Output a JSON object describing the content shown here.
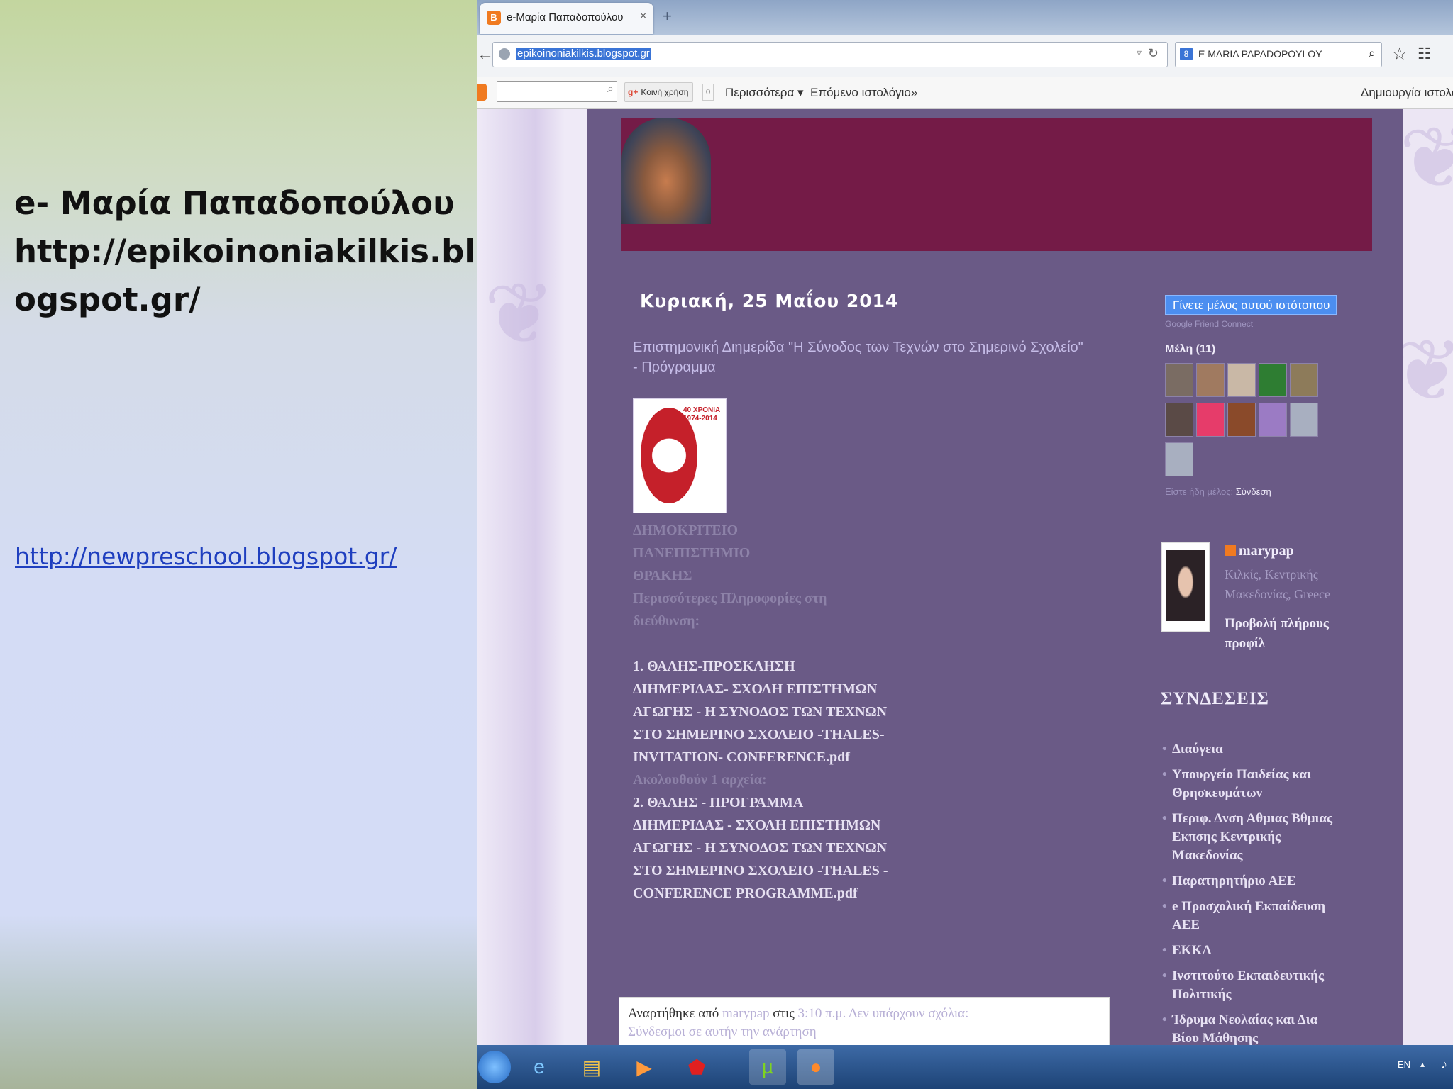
{
  "slide": {
    "title_lines": [
      "e- Μαρία Παπαδοπούλου",
      "http://epikoinoniakilkis.bl",
      "ogspot.gr/"
    ],
    "link": "http://newpreschool.blogspot.gr/"
  },
  "browser": {
    "tab_title": "e-Μαρία Παπαδοπούλου",
    "tab_close": "×",
    "new_tab": "+",
    "url": "epikoinoniakilkis.blogspot.gr",
    "search_text": "E MARIA PAPADOPOYLOY",
    "icons": [
      "back-arrow-icon",
      "reload-icon",
      "search-icon",
      "star-icon",
      "bookmarks-icon"
    ]
  },
  "blogger_bar": {
    "gplus_label": "Κοινή χρήση",
    "gplus_count": "0",
    "more_label": "Περισσότερα ▾",
    "next_blog": "Επόμενο ιστολόγιο»",
    "create_blog": "Δημιουργία ιστολογίου"
  },
  "post": {
    "date": "Κυριακή, 25 Μαΐου 2014",
    "title": "Επιστημονική Διημερίδα \"Η Σύνοδος των Τεχνών στο Σημερινό Σχολείο\" - Πρόγραμμα",
    "seal_text": "40 ΧΡΟΝΙΑ 1974-2014",
    "intro_lines": [
      "ΔΗΜΟΚΡΙΤΕΙΟ",
      "ΠΑΝΕΠΙΣΤΗΜΙΟ",
      "ΘΡΑΚΗΣ",
      "Περισσότερες Πληροφορίες στη",
      "διεύθυνση:"
    ],
    "item1": [
      "1. ΘΑΛΗΣ-ΠΡΟΣΚΛΗΣΗ",
      "ΔΙΗΜΕΡΙΔΑΣ- ΣΧΟΛΗ ΕΠΙΣΤΗΜΩΝ",
      "ΑΓΩΓΗΣ - Η ΣΥΝΟΔΟΣ ΤΩΝ ΤΕΧΝΩΝ",
      "ΣΤΟ ΣΗΜΕΡΙΝΟ ΣΧΟΛΕΙΟ -THALES-",
      "INVITATION- CONFERENCE.pdf"
    ],
    "follow_note": "Ακολουθούν 1 αρχεία:",
    "item2": [
      "2. ΘΑΛΗΣ - ΠΡΟΓΡΑΜΜΑ",
      "ΔΙΗΜΕΡΙΔΑΣ - ΣΧΟΛΗ ΕΠΙΣΤΗΜΩΝ",
      "ΑΓΩΓΗΣ - Η ΣΥΝΟΔΟΣ ΤΩΝ ΤΕΧΝΩΝ",
      "ΣΤΟ ΣΗΜΕΡΙΝΟ ΣΧΟΛΕΙΟ -THALES -",
      "CONFERENCE PROGRAMME.pdf"
    ],
    "footer": {
      "posted_by": "Αναρτήθηκε από",
      "author": "marypap",
      "at": "στις",
      "time": "3:10 π.μ.",
      "comments": "Δεν υπάρχουν σχόλια:",
      "link_line": "Σύνδεσμοι σε αυτήν την ανάρτηση"
    }
  },
  "sidebar": {
    "follow_button": "Γίνετε μέλος αυτού ιστότοπου",
    "gfc": "Google Friend Connect",
    "members_label": "Μέλη (11)",
    "member_colors": [
      "#7a6c63",
      "#a07a60",
      "#c9b8a6",
      "#2e7d32",
      "#8d7b5a",
      "#5a4a46",
      "#e63c6a",
      "#8a4a2a",
      "#9b7bc4",
      "#a8afc0",
      "#a8afc0"
    ],
    "signin_prefix": "Είστε ήδη μέλος;",
    "signin_link": "Σύνδεση",
    "profile_name": "marypap",
    "profile_location": "Κιλκίς, Κεντρικής Μακεδονίας, Greece",
    "profile_view": "Προβολή πλήρους προφίλ",
    "links_heading": "ΣΥΝΔΕΣΕΙΣ",
    "links": [
      "Διαύγεια",
      "Υπουργείο Παιδείας και Θρησκευμάτων",
      "Περιφ. Δνση Αθμιας Βθμιας Εκπσης Κεντρικής Μακεδονίας",
      "Παρατηρητήριο ΑΕΕ",
      "e Προσχολική Εκπαίδευση ΑΕΕ",
      "ΕΚΚΑ",
      "Ινστιτούτο Εκπαιδευτικής Πολιτικής",
      "Ίδρυμα Νεολαίας και Δια Βίου Μάθησης"
    ]
  },
  "taskbar": {
    "lang": "EN",
    "tray_arrow": "▴",
    "apps": [
      "windows-start",
      "internet-explorer",
      "file-explorer",
      "media-player",
      "adobe-reader",
      "utorrent",
      "firefox"
    ]
  }
}
